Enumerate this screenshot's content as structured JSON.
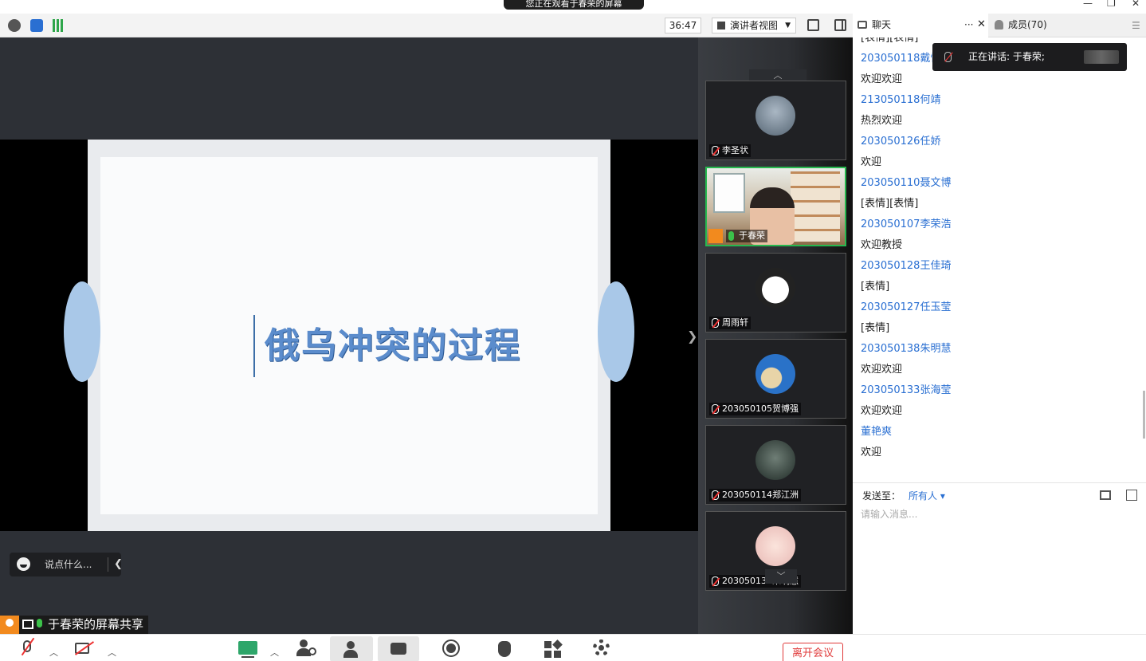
{
  "share_banner": "您正在观看于春荣的屏幕",
  "toolbar": {
    "timer": "36:47",
    "view_label": "演讲者视图"
  },
  "slide": {
    "title": "俄乌冲突的过程"
  },
  "say_box": {
    "placeholder": "说点什么..."
  },
  "sharer_label": "于春荣的屏幕共享",
  "participants": [
    {
      "name": "李圣状",
      "muted": true
    },
    {
      "name": "于春荣",
      "muted": false,
      "active": true
    },
    {
      "name": "周雨轩",
      "muted": true
    },
    {
      "name": "203050105贺博强",
      "muted": true
    },
    {
      "name": "203050114郑江洲",
      "muted": true
    },
    {
      "name": "203050138朱明慧",
      "muted": true
    }
  ],
  "chat_panel": {
    "tab_chat": "聊天",
    "tab_members": "成员(70)",
    "more": "···",
    "close": "✕",
    "speaking": "正在讲话: 于春荣;",
    "messages": [
      {
        "type": "text",
        "content": "[表情][表情]"
      },
      {
        "type": "sender",
        "content": "203050118戴恒"
      },
      {
        "type": "text",
        "content": "欢迎欢迎"
      },
      {
        "type": "sender",
        "content": "213050118何靖"
      },
      {
        "type": "text",
        "content": "热烈欢迎"
      },
      {
        "type": "sender",
        "content": "203050126任娇"
      },
      {
        "type": "text",
        "content": "欢迎"
      },
      {
        "type": "sender",
        "content": "203050110聂文博"
      },
      {
        "type": "text",
        "content": "[表情][表情]"
      },
      {
        "type": "sender",
        "content": "203050107李荣浩"
      },
      {
        "type": "text",
        "content": "欢迎教授"
      },
      {
        "type": "sender",
        "content": "203050128王佳琦"
      },
      {
        "type": "text",
        "content": "[表情]"
      },
      {
        "type": "sender",
        "content": "203050127任玉莹"
      },
      {
        "type": "text",
        "content": "[表情]"
      },
      {
        "type": "sender",
        "content": "203050138朱明慧"
      },
      {
        "type": "text",
        "content": "欢迎欢迎"
      },
      {
        "type": "sender",
        "content": "203050133张海莹"
      },
      {
        "type": "text",
        "content": "欢迎欢迎"
      },
      {
        "type": "sender",
        "content": "董艳爽"
      },
      {
        "type": "text",
        "content": "欢迎"
      }
    ],
    "send_to_label": "发送至：",
    "send_to_value": "所有人",
    "input_placeholder": "请输入消息..."
  },
  "bottom_bar": {
    "leave_label": "离开会议"
  }
}
